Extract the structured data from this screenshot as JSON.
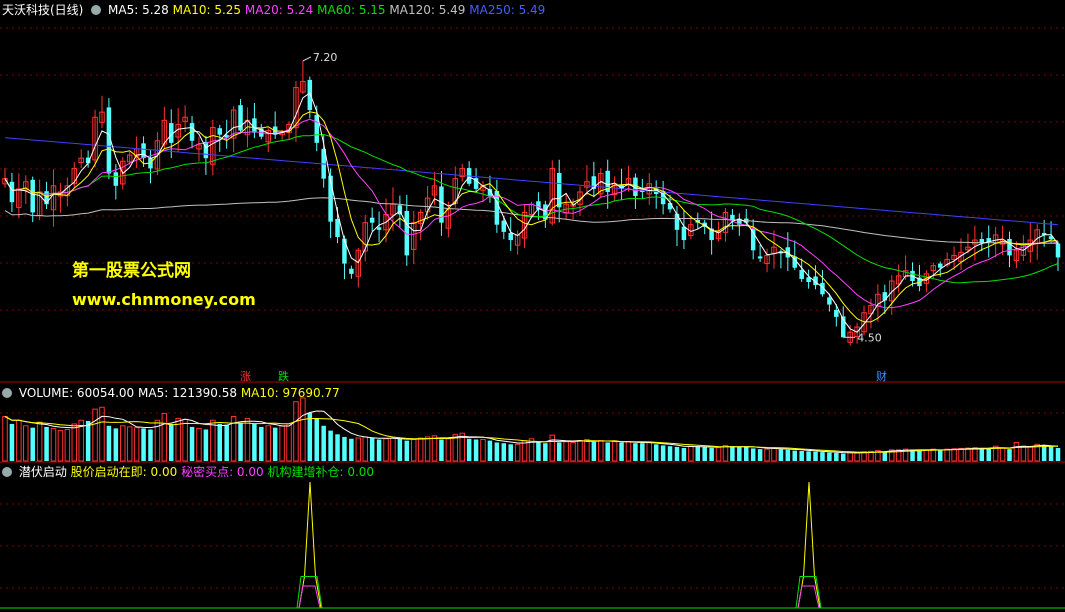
{
  "header": {
    "stock": "天沃科技(日线)",
    "ma5": "MA5: 5.28",
    "ma10": "MA10: 5.25",
    "ma20": "MA20: 5.24",
    "ma60": "MA60: 5.15",
    "ma120": "MA120: 5.49",
    "ma250": "MA250: 5.49"
  },
  "volume_header": {
    "volume": "VOLUME: 60054.00",
    "ma5": "MA5: 121390.58",
    "ma10": "MA10: 97690.77"
  },
  "indicator_header": {
    "name": "潜伏启动",
    "start": "股价启动在即: 0.00",
    "secret": "秘密买点: 0.00",
    "inst": "机构建增补仓: 0.00"
  },
  "watermark": {
    "title": "第一股票公式网",
    "url": "www.chnmoney.com"
  },
  "colors": {
    "up": "#ff3232",
    "down": "#54ffff",
    "ma5": "#ffffff",
    "ma10": "#ffff00",
    "ma20": "#ff40ff",
    "ma60": "#00e000",
    "ma120": "#c0c0c0",
    "ma250": "#4040ff",
    "grid": "#800000"
  },
  "chart_data": [
    {
      "type": "candlestick",
      "high_label": "7.20",
      "low_label": "4.50",
      "annotations": {
        "up": "涨",
        "down": "跌",
        "finance": "财"
      },
      "ylim": [
        4.2,
        7.6
      ],
      "close": [
        6.05,
        5.82,
        5.95,
        6.02,
        5.72,
        5.92,
        5.8,
        5.98,
        5.92,
        5.98,
        6.15,
        6.25,
        6.2,
        6.65,
        6.7,
        6.1,
        5.98,
        6.22,
        6.28,
        6.34,
        6.25,
        6.15,
        6.42,
        6.62,
        6.4,
        6.58,
        6.65,
        6.42,
        6.38,
        6.25,
        6.55,
        6.48,
        6.45,
        6.72,
        6.52,
        6.62,
        6.5,
        6.46,
        6.52,
        6.48,
        6.5,
        6.58,
        6.94,
        7.0,
        6.72,
        6.4,
        6.05,
        5.63,
        5.48,
        5.22,
        5.12,
        5.35,
        5.62,
        5.62,
        5.55,
        5.7,
        5.8,
        5.7,
        5.3,
        5.62,
        5.72,
        5.86,
        5.98,
        5.62,
        5.75,
        6.05,
        6.15,
        6.0,
        5.95,
        5.98,
        5.88,
        5.6,
        5.53,
        5.45,
        5.5,
        5.72,
        5.8,
        5.75,
        5.65,
        6.15,
        5.77,
        5.8,
        5.8,
        5.92,
        6.02,
        5.95,
        6.1,
        5.92,
        6.0,
        5.95,
        6.05,
        5.88,
        5.92,
        6.0,
        5.9,
        5.8,
        5.75,
        5.55,
        5.45,
        5.6,
        5.62,
        5.58,
        5.45,
        5.53,
        5.72,
        5.65,
        5.6,
        5.62,
        5.35,
        5.27,
        5.3,
        5.38,
        5.32,
        5.28,
        5.18,
        5.07,
        5.04,
        5.01,
        4.92,
        4.82,
        4.7,
        4.5,
        4.55,
        4.6,
        4.74,
        4.81,
        4.92,
        4.86,
        5.05,
        5.1,
        5.15,
        5.05,
        5.0,
        5.12,
        5.2,
        5.18,
        5.26,
        5.3,
        5.33,
        5.38,
        5.45,
        5.42,
        5.43,
        5.5,
        5.45,
        5.3,
        5.35,
        5.4,
        5.45,
        5.55,
        5.5,
        5.46,
        5.28
      ]
    },
    {
      "type": "bar",
      "name": "VOLUME",
      "values": [
        120,
        100,
        110,
        95,
        90,
        105,
        92,
        88,
        82,
        85,
        100,
        110,
        108,
        140,
        145,
        95,
        88,
        95,
        92,
        90,
        88,
        85,
        110,
        128,
        100,
        115,
        112,
        92,
        88,
        85,
        110,
        100,
        98,
        120,
        102,
        115,
        100,
        92,
        95,
        90,
        95,
        100,
        160,
        170,
        130,
        115,
        95,
        82,
        72,
        65,
        60,
        62,
        65,
        62,
        58,
        60,
        62,
        60,
        55,
        58,
        62,
        65,
        68,
        58,
        60,
        72,
        75,
        60,
        58,
        58,
        55,
        50,
        48,
        45,
        45,
        55,
        60,
        52,
        48,
        70,
        50,
        52,
        50,
        55,
        58,
        52,
        55,
        50,
        52,
        50,
        52,
        48,
        48,
        50,
        45,
        42,
        40,
        38,
        35,
        40,
        40,
        38,
        35,
        36,
        42,
        40,
        38,
        38,
        34,
        32,
        32,
        34,
        32,
        30,
        28,
        27,
        26,
        25,
        24,
        23,
        22,
        20,
        22,
        22,
        25,
        26,
        28,
        26,
        30,
        30,
        32,
        30,
        28,
        30,
        32,
        30,
        32,
        33,
        34,
        35,
        36,
        34,
        35,
        40,
        35,
        32,
        50,
        40,
        38,
        45,
        42,
        40,
        35
      ]
    },
    {
      "type": "line",
      "name": "潜伏启动",
      "series": [
        {
          "name": "股价启动在即",
          "values": [
            0,
            0.25,
            1,
            0.25,
            0
          ]
        },
        {
          "name": "秘密买点",
          "values": [
            0,
            0.25,
            0.25,
            0
          ]
        },
        {
          "name": "机构建增补仓",
          "values": [
            0,
            0.25,
            0.25,
            0
          ]
        }
      ]
    }
  ]
}
